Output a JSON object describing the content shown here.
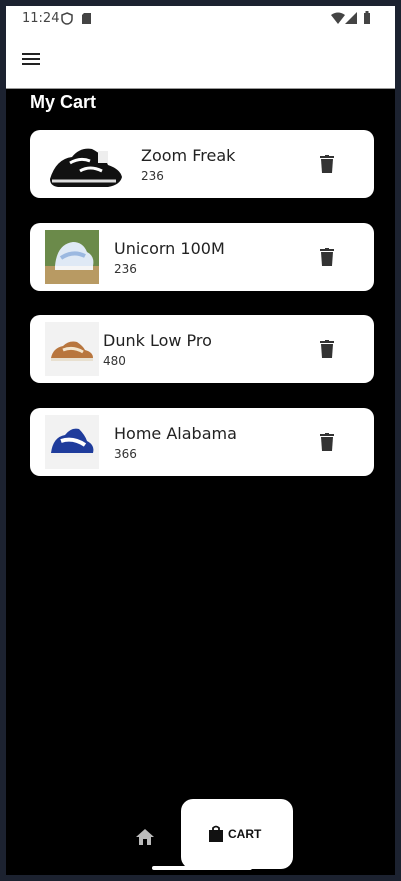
{
  "status": {
    "time": "11:24"
  },
  "appbar": {
    "menu_icon": "menu-icon"
  },
  "page": {
    "title": "My Cart"
  },
  "cart": {
    "items": [
      {
        "name": "Zoom Freak",
        "price": "236"
      },
      {
        "name": "Unicorn 100M",
        "price": "236"
      },
      {
        "name": "Dunk Low Pro",
        "price": "480"
      },
      {
        "name": "Home Alabama",
        "price": "366"
      }
    ]
  },
  "nav": {
    "cart_label": "CART"
  },
  "colors": {
    "background": "#000000",
    "card": "#ffffff",
    "accent": "#222222"
  }
}
